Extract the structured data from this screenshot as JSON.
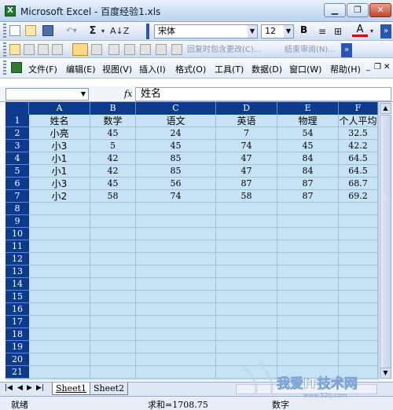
{
  "window": {
    "icon": "excel-icon",
    "title": "Microsoft Excel - 百度经验1.xls",
    "buttons": [
      "minimize-icon",
      "restore-icon",
      "close-icon"
    ]
  },
  "toolbar": {
    "font_name": "宋体",
    "font_size": "12",
    "bold_label": "B",
    "sum_label": "Σ",
    "review_reply_label": "回复时包含更改(C)...",
    "review_end_label": "结束审阅(N)..."
  },
  "menu": {
    "items": [
      "文件(F)",
      "编辑(E)",
      "视图(V)",
      "插入(I)",
      "格式(O)",
      "工具(T)",
      "数据(D)",
      "窗口(W)",
      "帮助(H)"
    ]
  },
  "formula_bar": {
    "name_box": "",
    "fx_label": "fx",
    "formula": "姓名"
  },
  "sheet": {
    "columns": [
      "A",
      "B",
      "C",
      "D",
      "E",
      "F"
    ],
    "row_numbers": [
      "1",
      "2",
      "3",
      "4",
      "5",
      "6",
      "7",
      "8",
      "9",
      "10",
      "11",
      "12",
      "13",
      "14",
      "15",
      "16",
      "17",
      "18",
      "19",
      "20",
      "21"
    ],
    "rows": [
      [
        "姓名",
        "数学",
        "语文",
        "英语",
        "物理",
        "个人平均"
      ],
      [
        "小亮",
        "45",
        "24",
        "7",
        "54",
        "32.5"
      ],
      [
        "小3",
        "5",
        "45",
        "74",
        "45",
        "42.2"
      ],
      [
        "小1",
        "42",
        "85",
        "47",
        "84",
        "64.5"
      ],
      [
        "小1",
        "42",
        "85",
        "47",
        "84",
        "64.5"
      ],
      [
        "小3",
        "45",
        "56",
        "87",
        "87",
        "68.7"
      ],
      [
        "小2",
        "58",
        "74",
        "58",
        "87",
        "69.2"
      ]
    ]
  },
  "tabs": {
    "sheets": [
      "Sheet1",
      "Sheet2"
    ],
    "active": "Sheet1"
  },
  "status": {
    "ready": "就绪",
    "sum": "求和=1708.75",
    "mode": "数字"
  },
  "watermark": {
    "text": "我爱IT技术网",
    "url": "www.52ij.com"
  },
  "colors": {
    "header_bg": "#0b3a8e",
    "selected_fill": "#c8e2f5",
    "gridline": "#9fc1d9"
  }
}
